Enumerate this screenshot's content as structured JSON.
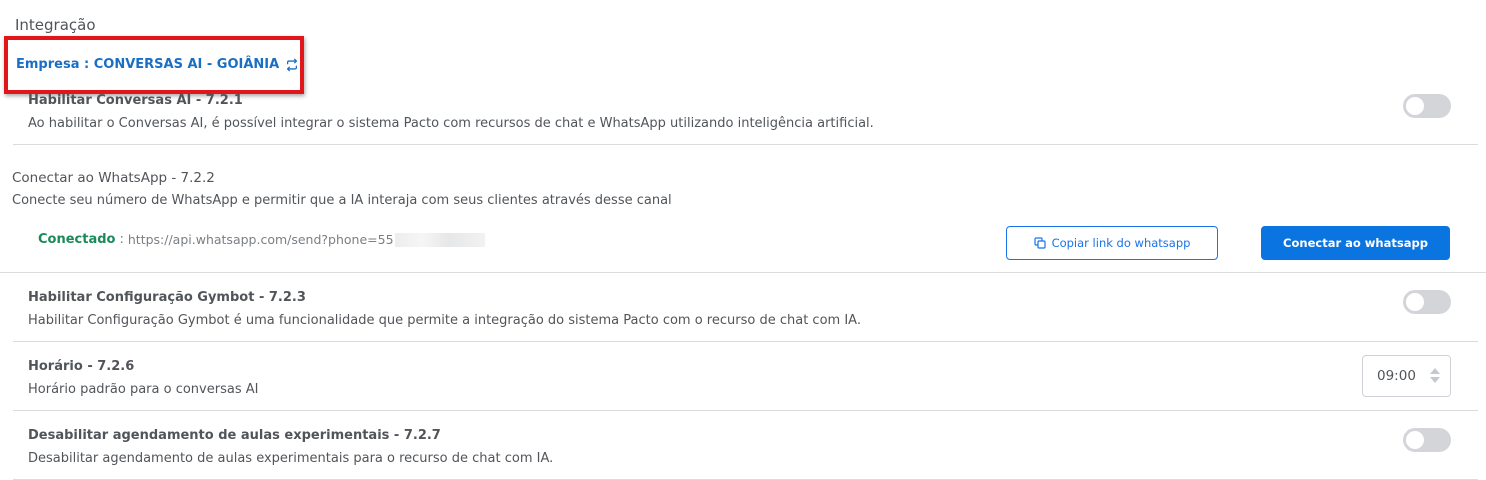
{
  "page": {
    "title": "Integração"
  },
  "company": {
    "label": "Empresa : CONVERSAS AI - GOIÂNIA",
    "icon": "swap-icon"
  },
  "conversas_ai": {
    "title": "Habilitar Conversas AI - 7.2.1",
    "description": "Ao habilitar o Conversas AI, é possível integrar o sistema Pacto com recursos de chat e WhatsApp utilizando inteligência artificial.",
    "enabled": false
  },
  "whatsapp": {
    "title": "Conectar ao WhatsApp - 7.2.2",
    "description": "Conecte seu número de WhatsApp e permitir que a IA interaja com seus clientes através desse canal",
    "status_label": "Conectado",
    "status_separator": ":",
    "status_url": "https://api.whatsapp.com/send?phone=55",
    "copy_button": "Copiar link do whatsapp",
    "connect_button": "Conectar ao whatsapp"
  },
  "gymbot": {
    "title": "Habilitar Configuração Gymbot - 7.2.3",
    "description": "Habilitar Configuração Gymbot é uma funcionalidade que permite a integração do sistema Pacto com o recurso de chat com IA.",
    "enabled": false
  },
  "schedule": {
    "title": "Horário - 7.2.6",
    "description": "Horário padrão para o conversas AI",
    "value": "09:00"
  },
  "trial_classes": {
    "title": "Desabilitar agendamento de aulas experimentais - 7.2.7",
    "description": "Desabilitar agendamento de aulas experimentais para o recurso de chat com IA.",
    "enabled": false
  },
  "colors": {
    "link_blue": "#1a6fc4",
    "primary_button": "#0a74e0",
    "success_green": "#1b8a5a",
    "highlight_red": "#e1161b",
    "toggle_off": "#d3d5d8"
  }
}
